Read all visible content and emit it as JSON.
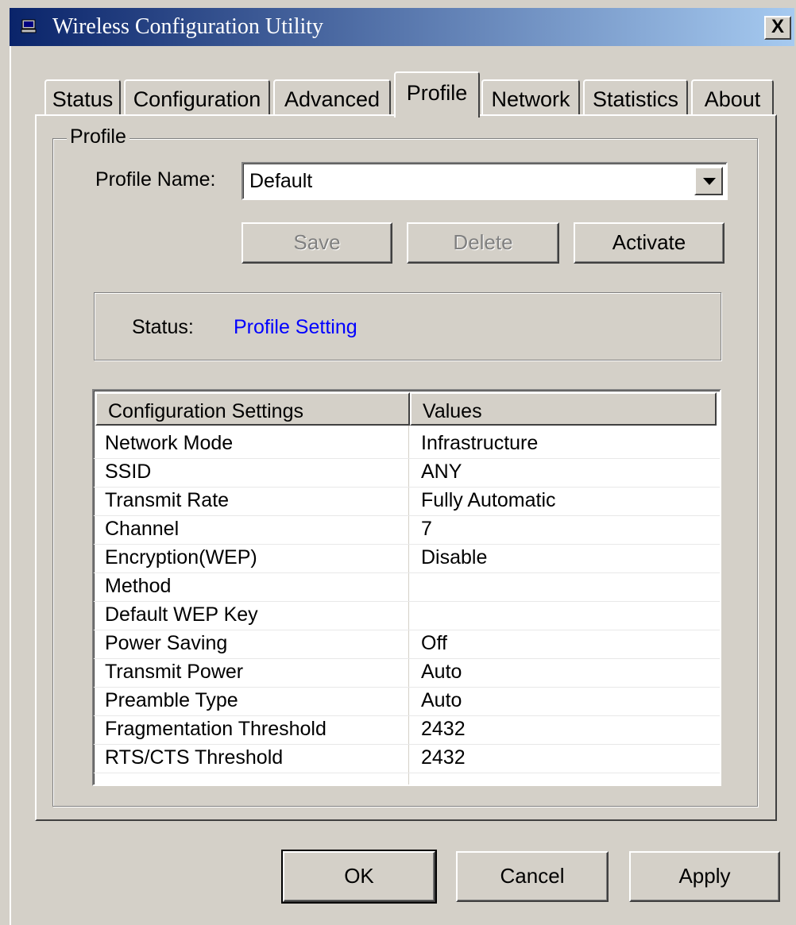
{
  "window": {
    "title": "Wireless Configuration Utility",
    "close_glyph": "X"
  },
  "tabs": [
    {
      "label": "Status"
    },
    {
      "label": "Configuration"
    },
    {
      "label": "Advanced"
    },
    {
      "label": "Profile",
      "active": true
    },
    {
      "label": "Network"
    },
    {
      "label": "Statistics"
    },
    {
      "label": "About"
    }
  ],
  "profile": {
    "group_label": "Profile",
    "name_label": "Profile Name:",
    "name_value": "Default",
    "buttons": {
      "save": "Save",
      "delete": "Delete",
      "activate": "Activate"
    },
    "status_label": "Status:",
    "status_value": "Profile Setting"
  },
  "settings_table": {
    "columns": [
      "Configuration Settings",
      "Values"
    ],
    "rows": [
      {
        "setting": "Network Mode",
        "value": "Infrastructure"
      },
      {
        "setting": "SSID",
        "value": "ANY"
      },
      {
        "setting": "Transmit Rate",
        "value": "Fully Automatic"
      },
      {
        "setting": "Channel",
        "value": "7"
      },
      {
        "setting": "Encryption(WEP)",
        "value": "Disable"
      },
      {
        "setting": "Method",
        "value": ""
      },
      {
        "setting": "Default WEP Key",
        "value": ""
      },
      {
        "setting": "Power Saving",
        "value": "Off"
      },
      {
        "setting": "Transmit Power",
        "value": "Auto"
      },
      {
        "setting": "Preamble Type",
        "value": "Auto"
      },
      {
        "setting": "Fragmentation Threshold",
        "value": "2432"
      },
      {
        "setting": "RTS/CTS Threshold",
        "value": "2432"
      }
    ]
  },
  "dialog_buttons": {
    "ok": "OK",
    "cancel": "Cancel",
    "apply": "Apply"
  },
  "colors": {
    "status_value": "#0000ff",
    "titlebar_start": "#0a246a",
    "titlebar_end": "#a6caf0"
  }
}
